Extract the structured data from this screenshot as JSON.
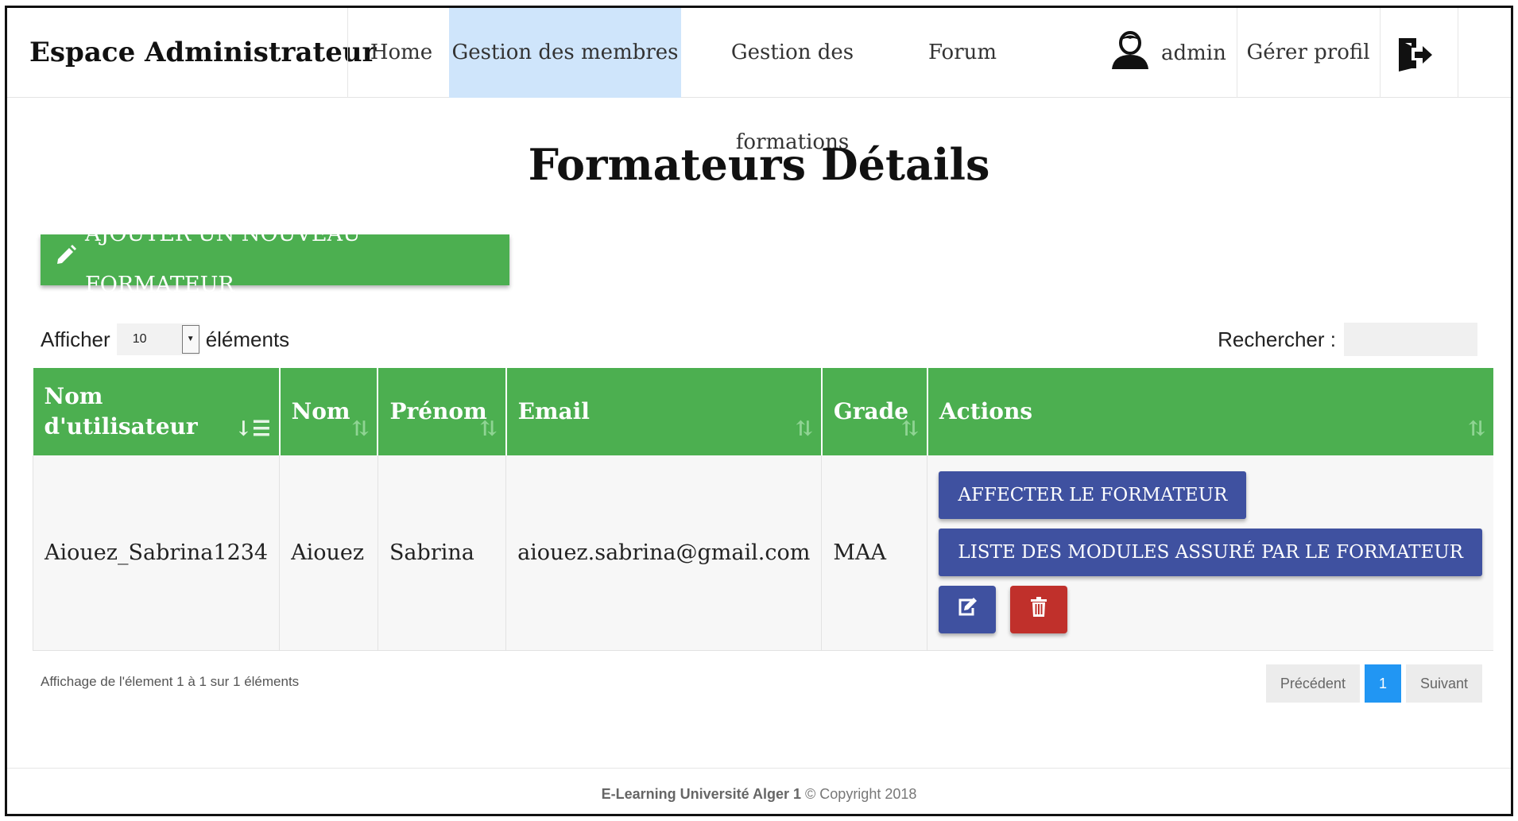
{
  "navbar": {
    "brand": "Espace Administrateur",
    "items": [
      {
        "label": "Home"
      },
      {
        "label": "Gestion des membres"
      },
      {
        "label": "Gestion des formations"
      },
      {
        "label": "Forum"
      }
    ],
    "active_item": "Gestion des membres",
    "user": {
      "name": "admin",
      "icon": "user-icon"
    },
    "manage_profile": "Gérer profil",
    "logout_icon": "logout-icon"
  },
  "page": {
    "title": "Formateurs Détails",
    "add_button": "AJOUTER UN NOUVEAU FORMATEUR"
  },
  "length_control": {
    "prefix": "Afficher",
    "value": "10",
    "suffix": "éléments"
  },
  "search": {
    "label": "Rechercher :",
    "value": ""
  },
  "table": {
    "columns": [
      "Nom d'utilisateur",
      "Nom",
      "Prénom",
      "Email",
      "Grade",
      "Actions"
    ],
    "rows": [
      {
        "username": "Aiouez_Sabrina1234",
        "nom": "Aiouez",
        "prenom": "Sabrina",
        "email": "aiouez.sabrina@gmail.com",
        "grade": "MAA",
        "actions": {
          "assign": "AFFECTER LE FORMATEUR",
          "modules": "LISTE DES MODULES ASSURÉ PAR LE FORMATEUR",
          "edit_icon": "edit-icon",
          "delete_icon": "trash-icon"
        }
      }
    ]
  },
  "pagination": {
    "info": "Affichage de l'élement 1 à 1 sur 1 éléments",
    "previous": "Précédent",
    "current": "1",
    "next": "Suivant"
  },
  "footer": {
    "brand": "E-Learning Université Alger 1",
    "copyright": "© Copyright 2018"
  },
  "colors": {
    "green": "#4caf50",
    "indigo": "#3f51a0",
    "red": "#c0302b",
    "active_nav": "#cfe5fb",
    "page_blue": "#2196f3"
  }
}
